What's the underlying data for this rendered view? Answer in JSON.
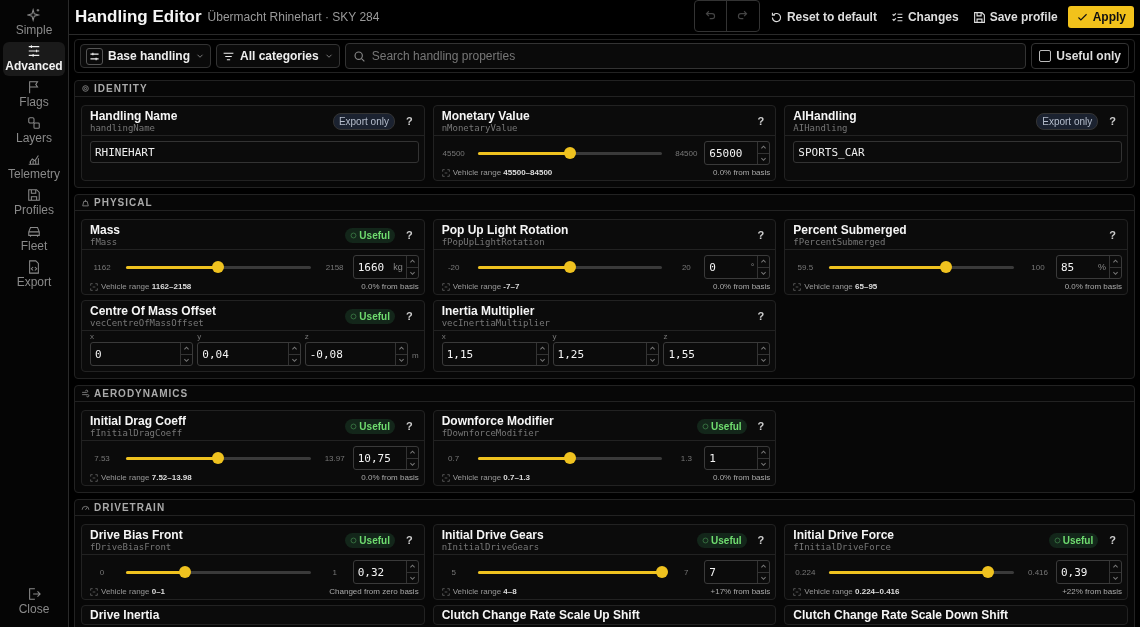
{
  "sidebar": {
    "items": [
      {
        "label": "Simple",
        "selected": false
      },
      {
        "label": "Advanced",
        "selected": true
      },
      {
        "label": "Flags",
        "selected": false
      },
      {
        "label": "Layers",
        "selected": false
      },
      {
        "label": "Telemetry",
        "selected": false
      },
      {
        "label": "Profiles",
        "selected": false
      },
      {
        "label": "Fleet",
        "selected": false
      },
      {
        "label": "Export",
        "selected": false
      }
    ],
    "close": "Close"
  },
  "header": {
    "title": "Handling Editor",
    "subtitle": "Übermacht Rhinehart · SKY 284",
    "undo_disabled": true,
    "redo_disabled": true,
    "reset": "Reset to default",
    "changes": "Changes",
    "save": "Save profile",
    "apply": "Apply"
  },
  "toolbar": {
    "mode": "Base handling",
    "category": "All categories",
    "search_placeholder": "Search handling properties",
    "useful_only": {
      "label": "Useful only",
      "checked": false
    }
  },
  "sections": [
    {
      "title": "IDENTITY",
      "cards": [
        {
          "kind": "text",
          "title": "Handling Name",
          "code": "handlingName",
          "badge": {
            "kind": "export",
            "text": "Export only"
          },
          "help": "?",
          "value": "RHINEHART"
        },
        {
          "kind": "slider",
          "title": "Monetary Value",
          "code": "nMonetaryValue",
          "help": "?",
          "min": "45500",
          "max": "84500",
          "level": 0.5,
          "value": "65000",
          "range": "Vehicle range **45500–84500**",
          "delta": "0.0% from basis"
        },
        {
          "kind": "text",
          "title": "AIHandling",
          "code": "AIHandling",
          "badge": {
            "kind": "export",
            "text": "Export only"
          },
          "help": "?",
          "value": "SPORTS_CAR"
        }
      ]
    },
    {
      "title": "PHYSICAL",
      "cards": [
        {
          "kind": "slider",
          "title": "Mass",
          "code": "fMass",
          "badge": {
            "kind": "useful",
            "text": "Useful"
          },
          "help": "?",
          "min": "1162",
          "max": "2158",
          "level": 0.5,
          "value": "1660",
          "unit": "kg",
          "range": "Vehicle range **1162–2158**",
          "delta": "0.0% from basis"
        },
        {
          "kind": "slider",
          "title": "Pop Up Light Rotation",
          "code": "fPopUpLightRotation",
          "help": "?",
          "min": "-20",
          "max": "20",
          "level": 0.5,
          "value": "0",
          "unit": "°",
          "range": "Vehicle range **-7–7**",
          "delta": "0.0% from basis"
        },
        {
          "kind": "slider",
          "title": "Percent Submerged",
          "code": "fPercentSubmerged",
          "help": "?",
          "min": "59.5",
          "max": "100",
          "level": 0.63,
          "value": "85",
          "unit": "%",
          "range": "Vehicle range **65–95**",
          "delta": "0.0% from basis"
        },
        {
          "kind": "vector",
          "title": "Centre Of Mass Offset",
          "code": "vecCentreOfMassOffset",
          "badge": {
            "kind": "useful",
            "text": "Useful"
          },
          "help": "?",
          "unit": "m",
          "axes": [
            {
              "label": "x",
              "value": "0"
            },
            {
              "label": "y",
              "value": "0,04"
            },
            {
              "label": "z",
              "value": "-0,08"
            }
          ]
        },
        {
          "kind": "vector",
          "title": "Inertia Multiplier",
          "code": "vecInertiaMultiplier",
          "help": "?",
          "axes": [
            {
              "label": "x",
              "value": "1,15"
            },
            {
              "label": "y",
              "value": "1,25"
            },
            {
              "label": "z",
              "value": "1,55"
            }
          ]
        }
      ]
    },
    {
      "title": "AERODYNAMICS",
      "cards": [
        {
          "kind": "slider",
          "title": "Initial Drag Coeff",
          "code": "fInitialDragCoeff",
          "badge": {
            "kind": "useful",
            "text": "Useful"
          },
          "help": "?",
          "min": "7.53",
          "max": "13.97",
          "level": 0.5,
          "value": "10,75",
          "range": "Vehicle range **7.52–13.98**",
          "delta": "0.0% from basis"
        },
        {
          "kind": "slider",
          "title": "Downforce Modifier",
          "code": "fDownforceModifier",
          "badge": {
            "kind": "useful",
            "text": "Useful"
          },
          "help": "?",
          "min": "0.7",
          "max": "1.3",
          "level": 0.5,
          "value": "1",
          "range": "Vehicle range **0.7–1.3**",
          "delta": "0.0% from basis"
        }
      ]
    },
    {
      "title": "DRIVETRAIN",
      "cards": [
        {
          "kind": "slider",
          "title": "Drive Bias Front",
          "code": "fDriveBiasFront",
          "badge": {
            "kind": "useful",
            "text": "Useful"
          },
          "help": "?",
          "min": "0",
          "max": "1",
          "level": 0.32,
          "value": "0,32",
          "range": "Vehicle range **0–1**",
          "delta": "Changed from zero basis"
        },
        {
          "kind": "slider",
          "title": "Initial Drive Gears",
          "code": "nInitialDriveGears",
          "badge": {
            "kind": "useful",
            "text": "Useful"
          },
          "help": "?",
          "min": "5",
          "max": "7",
          "level": 1,
          "value": "7",
          "range": "Vehicle range **4–8**",
          "delta": "+17% from basis"
        },
        {
          "kind": "slider",
          "title": "Initial Drive Force",
          "code": "fInitialDriveForce",
          "badge": {
            "kind": "useful",
            "text": "Useful"
          },
          "help": "?",
          "min": "0.224",
          "max": "0.416",
          "level": 0.86,
          "value": "0,39",
          "range": "Vehicle range **0.224–0.416**",
          "delta": "+22% from basis"
        },
        {
          "kind": "partial",
          "title": "Drive Inertia"
        },
        {
          "kind": "partial",
          "title": "Clutch Change Rate Scale Up Shift"
        },
        {
          "kind": "partial",
          "title": "Clutch Change Rate Scale Down Shift"
        }
      ]
    }
  ]
}
